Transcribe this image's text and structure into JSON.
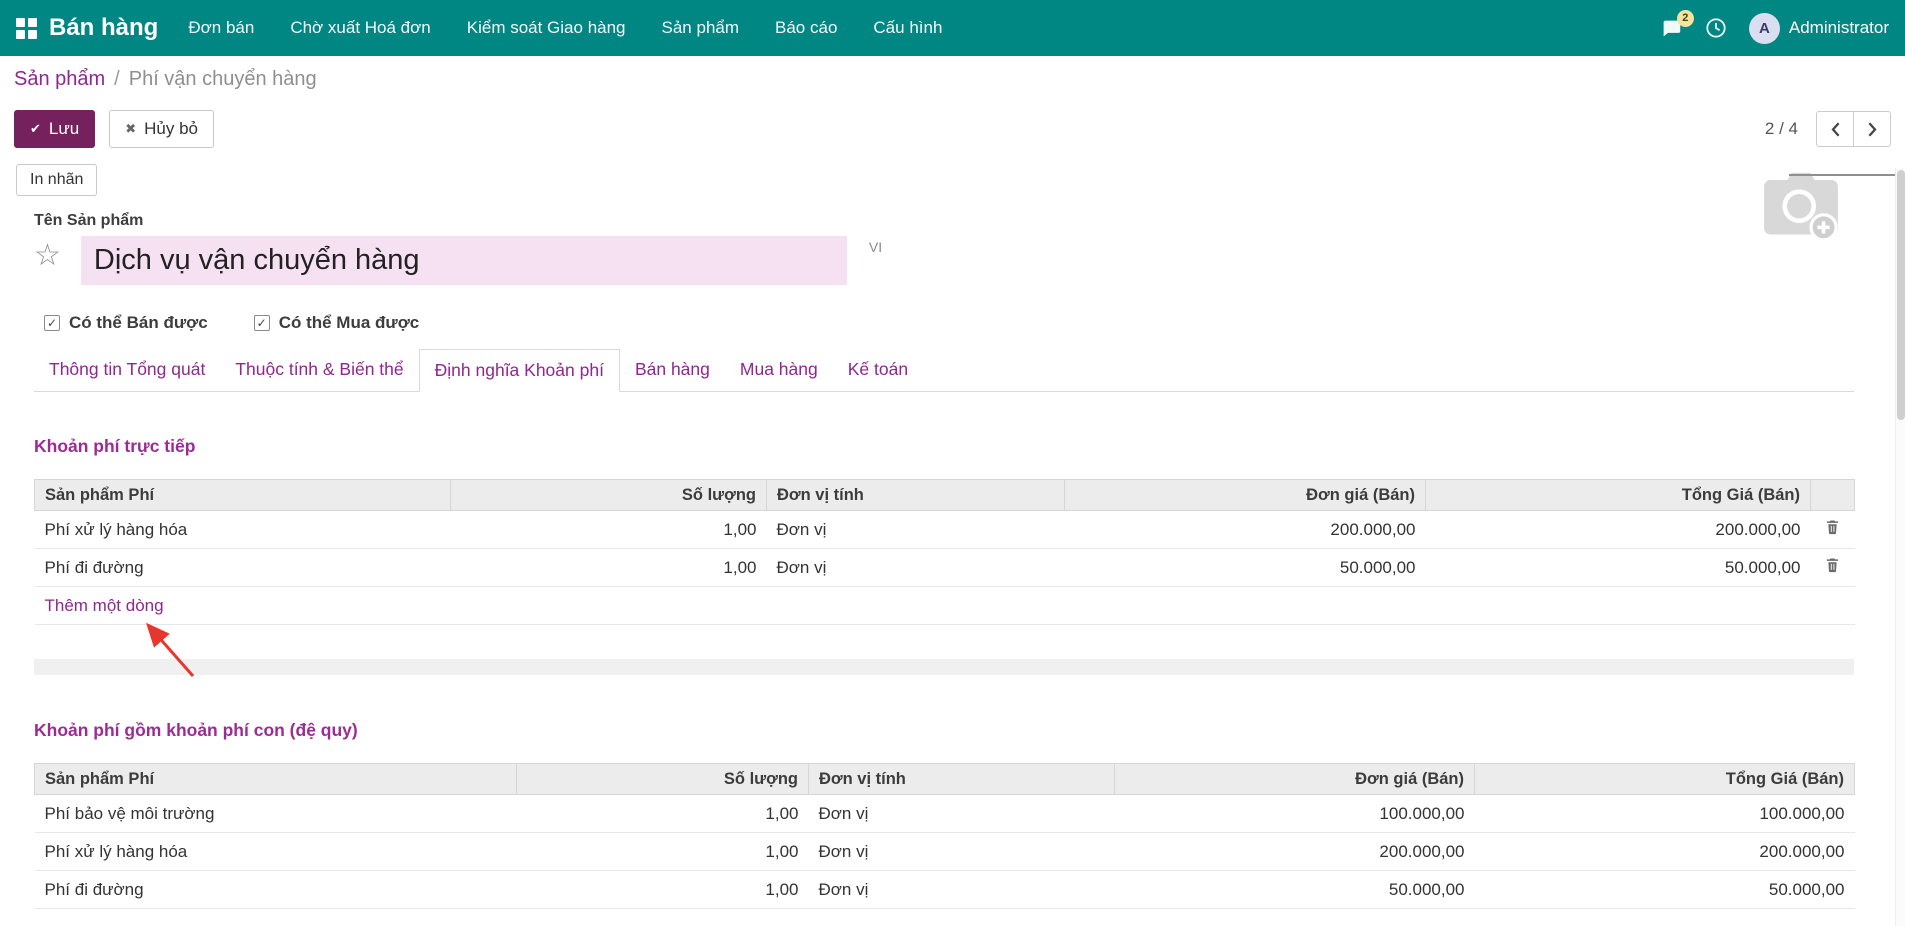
{
  "colors": {
    "navbar_teal": "#008784",
    "primary_button": "#75215d",
    "accent_purple": "#8f278f",
    "section_heading": "#9c2c94",
    "name_input_bg": "#f6e1f3",
    "annotation_red": "#e8352e"
  },
  "icons": {
    "save_icon": "✔",
    "discard_icon": "✖",
    "star_icon": "☆",
    "checkbox_check": "✓"
  },
  "navbar": {
    "app_name": "Bán hàng",
    "menu_items": [
      "Đơn bán",
      "Chờ xuất Hoá đơn",
      "Kiểm soát Giao hàng",
      "Sản phẩm",
      "Báo cáo",
      "Cấu hình"
    ],
    "messages_badge": "2",
    "user_initial": "A",
    "user_name": "Administrator"
  },
  "breadcrumb": {
    "parent": "Sản phẩm",
    "separator": "/",
    "current": "Phí vận chuyển hàng"
  },
  "control_panel": {
    "save_label": "Lưu",
    "discard_label": "Hủy bỏ",
    "pager_value": "2 / 4"
  },
  "actions": {
    "print_label": "In nhãn"
  },
  "form": {
    "name_label": "Tên Sản phẩm",
    "product_name": "Dịch vụ vận chuyển hàng",
    "lang_badge": "VI",
    "checkbox_sale": {
      "label": "Có thể Bán được",
      "checked": true
    },
    "checkbox_purchase": {
      "label": "Có thể Mua được",
      "checked": true
    },
    "tabs": [
      {
        "label": "Thông tin Tổng quát",
        "active": false
      },
      {
        "label": "Thuộc tính & Biến thể",
        "active": false
      },
      {
        "label": "Định nghĩa Khoản phí",
        "active": true
      },
      {
        "label": "Bán hàng",
        "active": false
      },
      {
        "label": "Mua hàng",
        "active": false
      },
      {
        "label": "Kế toán",
        "active": false
      }
    ]
  },
  "direct_fees": {
    "title": "Khoản phí trực tiếp",
    "columns": [
      "Sản phẩm Phí",
      "Số lượng",
      "Đơn vị tính",
      "Đơn giá (Bán)",
      "Tổng Giá (Bán)"
    ],
    "rows": [
      {
        "product": "Phí xử lý hàng hóa",
        "qty": "1,00",
        "uom": "Đơn vị",
        "price": "200.000,00",
        "total": "200.000,00"
      },
      {
        "product": "Phí đi đường",
        "qty": "1,00",
        "uom": "Đơn vị",
        "price": "50.000,00",
        "total": "50.000,00"
      }
    ],
    "add_line_label": "Thêm một dòng"
  },
  "recursive_fees": {
    "title": "Khoản phí gồm khoản phí con (đệ quy)",
    "columns": [
      "Sản phẩm Phí",
      "Số lượng",
      "Đơn vị tính",
      "Đơn giá (Bán)",
      "Tổng Giá (Bán)"
    ],
    "rows": [
      {
        "product": "Phí bảo vệ môi trường",
        "qty": "1,00",
        "uom": "Đơn vị",
        "price": "100.000,00",
        "total": "100.000,00"
      },
      {
        "product": "Phí xử lý hàng hóa",
        "qty": "1,00",
        "uom": "Đơn vị",
        "price": "200.000,00",
        "total": "200.000,00"
      },
      {
        "product": "Phí đi đường",
        "qty": "1,00",
        "uom": "Đơn vị",
        "price": "50.000,00",
        "total": "50.000,00"
      }
    ]
  }
}
